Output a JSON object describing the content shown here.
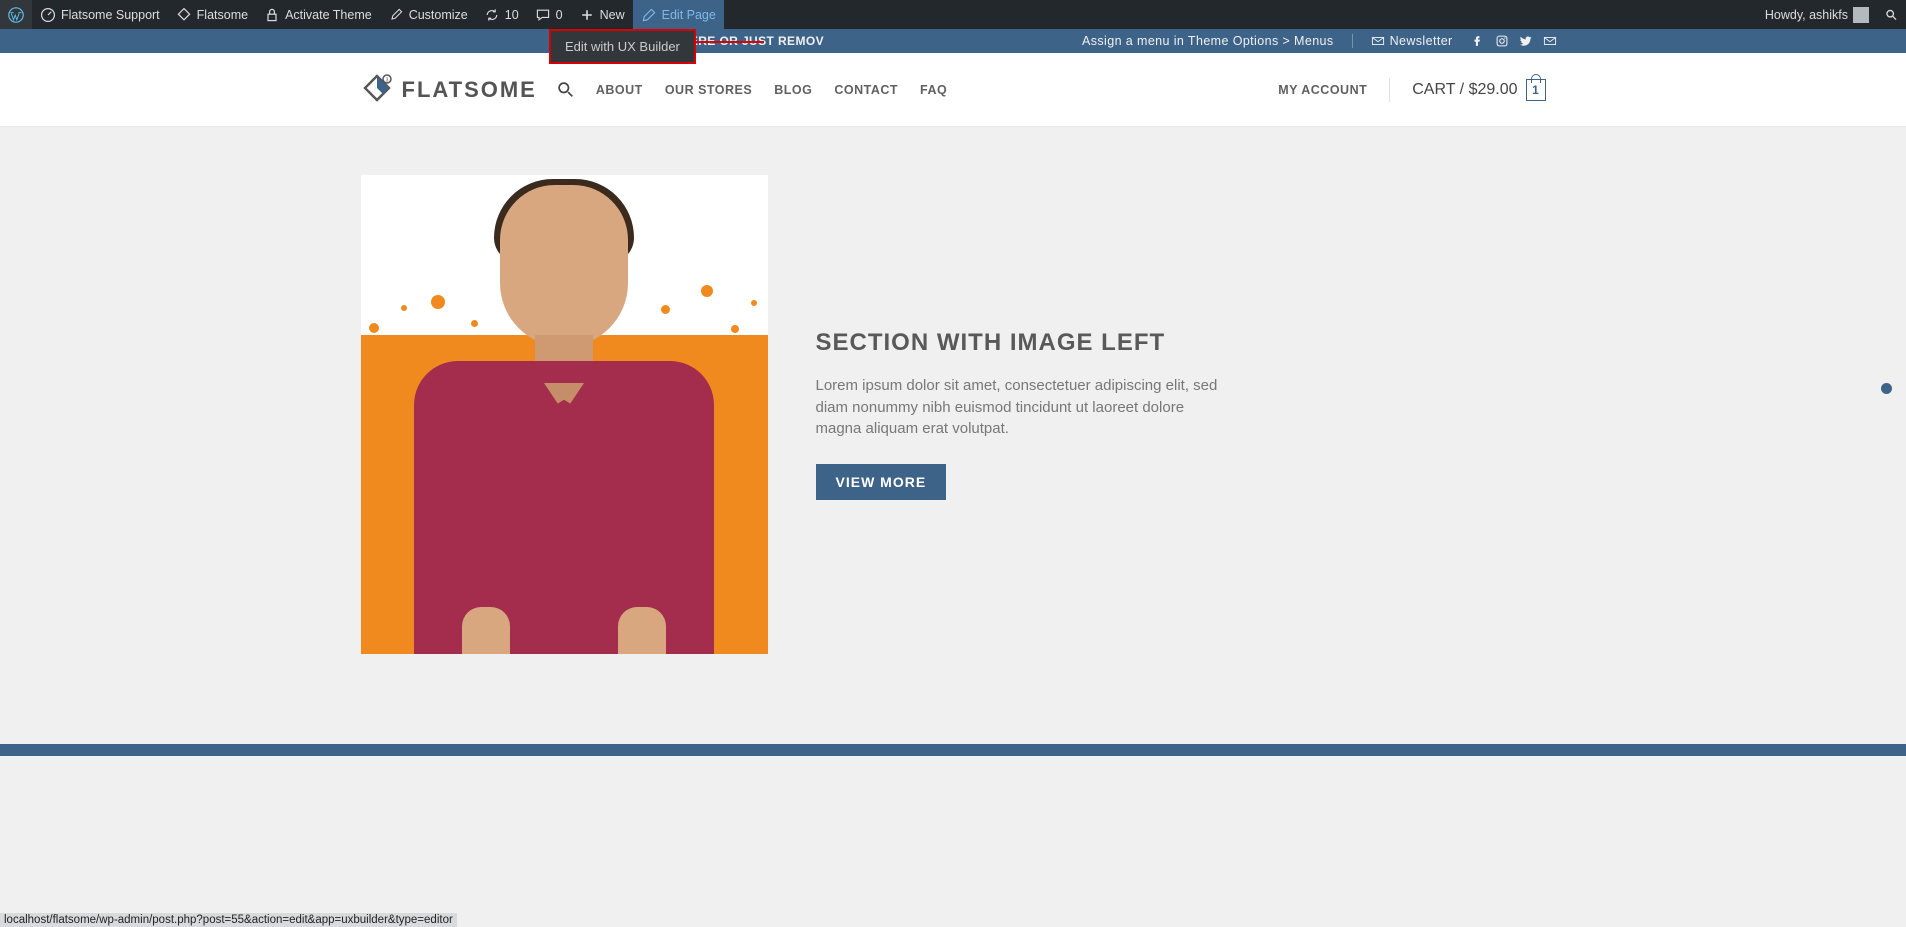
{
  "adminbar": {
    "items": [
      {
        "label": "",
        "icon": "wp"
      },
      {
        "label": "Flatsome Support",
        "icon": "dashboard"
      },
      {
        "label": "Flatsome",
        "icon": "flatsome"
      },
      {
        "label": "Activate Theme",
        "icon": "lock"
      },
      {
        "label": "Customize",
        "icon": "brush"
      },
      {
        "label": "10",
        "icon": "refresh"
      },
      {
        "label": "0",
        "icon": "comment"
      },
      {
        "label": "New",
        "icon": "plus"
      },
      {
        "label": "Edit Page",
        "icon": "pencil",
        "active": true
      }
    ],
    "greeting": "Howdy, ashikfs",
    "dropdown": "Edit with UX Builder"
  },
  "topbar": {
    "left": "ADD ANYTHING HERE OR JUST REMOV",
    "right_link": "Assign a menu in Theme Options > Menus",
    "newsletter": "Newsletter"
  },
  "header": {
    "logo_text": "FLATSOME",
    "nav": [
      "ABOUT",
      "OUR STORES",
      "BLOG",
      "CONTACT",
      "FAQ"
    ],
    "account": "MY ACCOUNT",
    "cart_label": "CART / $29.00",
    "cart_count": "1"
  },
  "section": {
    "title": "SECTION WITH IMAGE LEFT",
    "body": "Lorem ipsum dolor sit amet, consectetuer adipiscing elit, sed diam nonummy nibh euismod tincidunt ut laoreet dolore magna aliquam erat volutpat.",
    "button": "VIEW MORE"
  },
  "status_url": "localhost/flatsome/wp-admin/post.php?post=55&action=edit&app=uxbuilder&type=editor"
}
